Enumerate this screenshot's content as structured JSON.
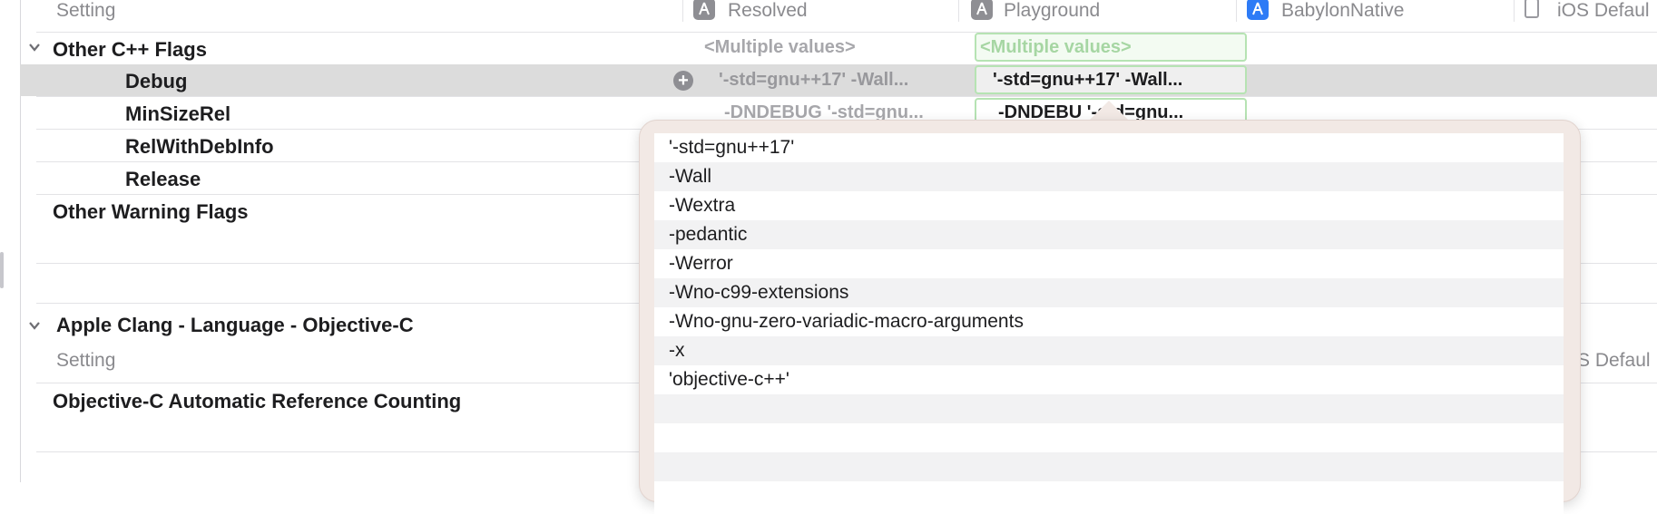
{
  "header": {
    "setting": "Setting",
    "columns": [
      {
        "label": "Resolved",
        "icon": "app-target-icon"
      },
      {
        "label": "Playground",
        "icon": "app-target-icon"
      },
      {
        "label": "BabylonNative",
        "icon": "app-target-icon-blue"
      },
      {
        "label": "iOS Defaul",
        "icon": "ios-device-icon"
      }
    ]
  },
  "sections": {
    "cpp_flags": {
      "title": "Other C++ Flags",
      "resolved": "<Multiple values>",
      "playground": "<Multiple values>",
      "rows": [
        {
          "label": "Debug",
          "resolved": "'-std=gnu++17' -Wall...",
          "playground": "'-std=gnu++17' -Wall..."
        },
        {
          "label": "MinSizeRel",
          "resolved": "-DNDEBUG '-std=gnu...",
          "playground": "-DNDEBU  '-std=gnu..."
        },
        {
          "label": "RelWithDebInfo"
        },
        {
          "label": "Release"
        }
      ]
    },
    "warning_flags": {
      "title": "Other Warning Flags"
    },
    "objc": {
      "title": "Apple Clang - Language - Objective-C",
      "setting": "Setting",
      "col_partial": "S Defaul",
      "arc": "Objective-C Automatic Reference Counting"
    }
  },
  "popover": {
    "items": [
      "'-std=gnu++17'",
      "-Wall",
      "-Wextra",
      "-pedantic",
      "-Werror",
      "-Wno-c99-extensions",
      "-Wno-gnu-zero-variadic-macro-arguments",
      "-x",
      "'objective-c++'",
      "",
      "",
      "",
      ""
    ]
  },
  "colors": {
    "accent_green": "#b6e3b3",
    "selection_gray": "#dcdcdc",
    "popover_bg": "#f2e9e5"
  }
}
